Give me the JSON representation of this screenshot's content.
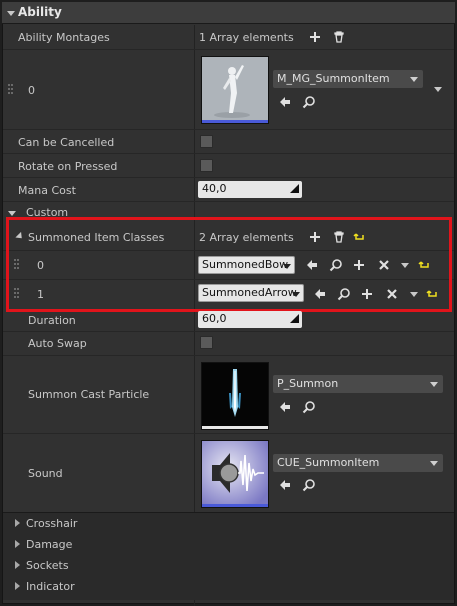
{
  "section": {
    "title": "Ability"
  },
  "ability_montages": {
    "label": "Ability Montages",
    "count_text": "1 Array elements",
    "index": "0",
    "asset_name": "M_MG_SummonItem"
  },
  "can_be_cancelled": {
    "label": "Can be Cancelled",
    "checked": false
  },
  "rotate_on_pressed": {
    "label": "Rotate on Pressed",
    "checked": false
  },
  "mana_cost": {
    "label": "Mana Cost",
    "value": "40,0"
  },
  "custom": {
    "label": "Custom"
  },
  "summoned_item_classes": {
    "label": "Summoned Item Classes",
    "count_text": "2 Array elements",
    "elements": [
      {
        "index": "0",
        "value": "SummonedBow"
      },
      {
        "index": "1",
        "value": "SummonedArrow"
      }
    ]
  },
  "duration": {
    "label": "Duration",
    "value": "60,0"
  },
  "auto_swap": {
    "label": "Auto Swap",
    "checked": false
  },
  "summon_cast_particle": {
    "label": "Summon Cast Particle",
    "asset_name": "P_Summon"
  },
  "sound": {
    "label": "Sound",
    "asset_name": "CUE_SummonItem"
  },
  "collapsed_sections": [
    "Crosshair",
    "Damage",
    "Sockets",
    "Indicator"
  ],
  "colors": {
    "highlight": "#e1141b",
    "reset_arrow": "#f0e020",
    "panel": "#313131"
  }
}
